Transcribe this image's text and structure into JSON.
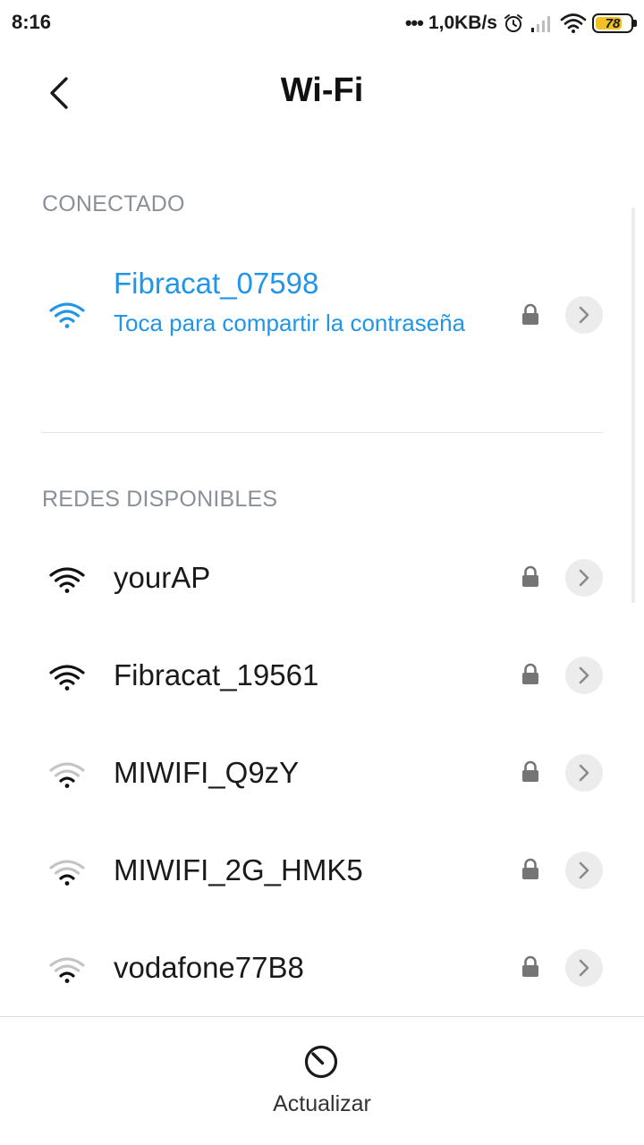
{
  "status_bar": {
    "time": "8:16",
    "dots": "•••",
    "network_speed": "1,0KB/s",
    "battery_level": "78",
    "battery_fraction": 0.78,
    "battery_color": "#f0c024"
  },
  "header": {
    "title": "Wi-Fi",
    "back_icon": "chevron-left-icon"
  },
  "connected": {
    "section_label": "CONECTADO",
    "network": {
      "name": "Fibracat_07598",
      "subtitle": "Toca para compartir la contraseña",
      "signal": "full",
      "secured": true,
      "accent_color": "#2196e8"
    }
  },
  "available": {
    "section_label": "REDES DISPONIBLES",
    "networks": [
      {
        "name": "yourAP",
        "signal": "full",
        "secured": true
      },
      {
        "name": "Fibracat_19561",
        "signal": "full",
        "secured": true
      },
      {
        "name": "MIWIFI_Q9zY",
        "signal": "weak",
        "secured": true
      },
      {
        "name": "MIWIFI_2G_HMK5",
        "signal": "weak",
        "secured": true
      },
      {
        "name": "vodafone77B8",
        "signal": "weak",
        "secured": true
      }
    ]
  },
  "bottom_bar": {
    "refresh_label": "Actualizar",
    "refresh_icon": "refresh-gauge-icon"
  }
}
